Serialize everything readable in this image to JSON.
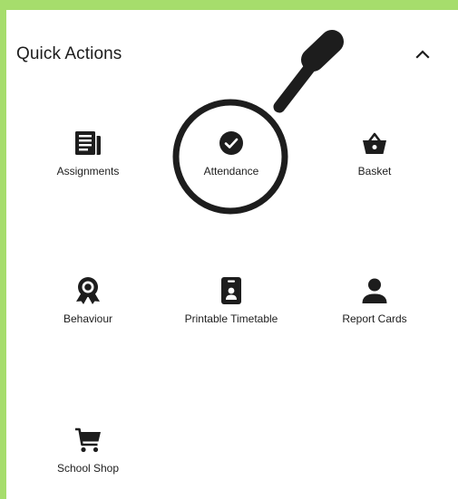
{
  "quick_actions": {
    "title": "Quick Actions",
    "collapse_icon": "chevron-up-icon",
    "items": [
      {
        "label": "Assignments",
        "icon": "newspaper-icon"
      },
      {
        "label": "Attendance",
        "icon": "check-circle-icon"
      },
      {
        "label": "Basket",
        "icon": "basket-icon"
      },
      {
        "label": "Behaviour",
        "icon": "award-ribbon-icon"
      },
      {
        "label": "Printable Timetable",
        "icon": "id-badge-icon"
      },
      {
        "label": "Report Cards",
        "icon": "person-icon"
      },
      {
        "label": "School Shop",
        "icon": "shopping-cart-icon"
      }
    ]
  },
  "overlay": {
    "icon": "magnifying-glass-icon"
  },
  "colors": {
    "frame_background": "#a6dd6c",
    "card_background": "#ffffff",
    "text": "#1d1d1d",
    "icon": "#1d1d1d"
  }
}
